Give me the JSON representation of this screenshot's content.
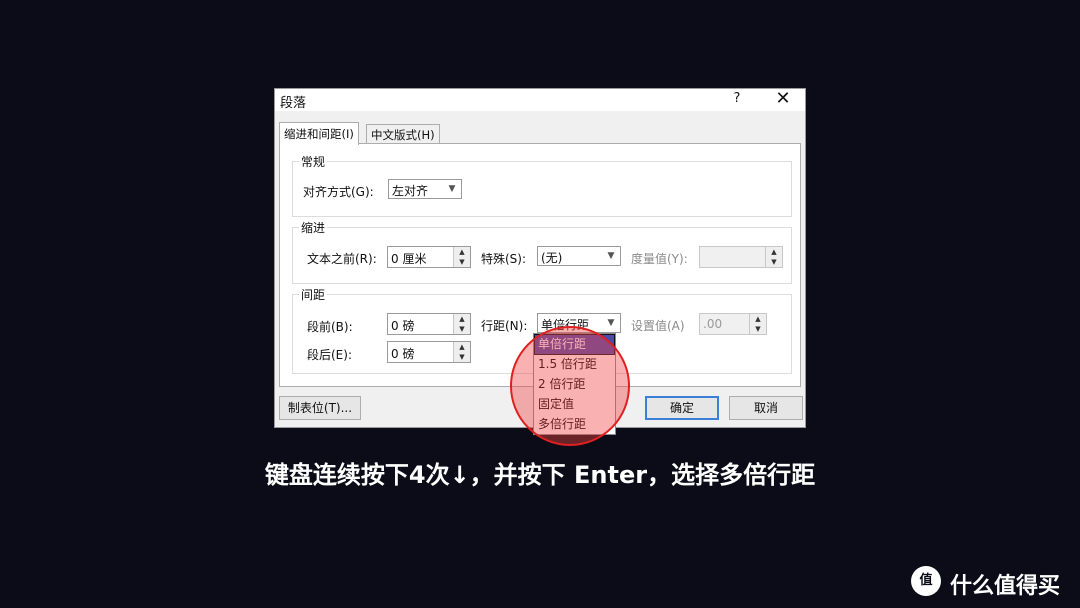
{
  "dialog": {
    "title": "段落",
    "help_label": "?",
    "close_label": "✕",
    "tabs": [
      {
        "label": "缩进和间距(I)"
      },
      {
        "label": "中文版式(H)"
      }
    ],
    "general": {
      "group_label": "常规",
      "alignment_label": "对齐方式(G):",
      "alignment_value": "左对齐"
    },
    "indent": {
      "group_label": "缩进",
      "before_text_label": "文本之前(R):",
      "before_text_value": "0 厘米",
      "special_label": "特殊(S):",
      "special_value": "(无)",
      "measure_label": "度量值(Y):",
      "measure_value": ""
    },
    "spacing": {
      "group_label": "间距",
      "before_label": "段前(B):",
      "before_value": "0 磅",
      "after_label": "段后(E):",
      "after_value": "0 磅",
      "line_spacing_label": "行距(N):",
      "line_spacing_value": "单倍行距",
      "set_value_label": "设置值(A)",
      "set_value_value": ".00"
    },
    "line_spacing_options": [
      "单倍行距",
      "1.5 倍行距",
      "2 倍行距",
      "固定值",
      "多倍行距"
    ],
    "buttons": {
      "tabs_label": "制表位(T)...",
      "ok_label": "确定",
      "cancel_label": "取消"
    }
  },
  "caption": "键盘连续按下4次↓，并按下 Enter，选择多倍行距",
  "watermark": {
    "logo": "值",
    "text": "什么值得买"
  },
  "colors": {
    "background": "#0b0c17",
    "selected_option": "#4a4bab",
    "highlight": "#e02020"
  }
}
